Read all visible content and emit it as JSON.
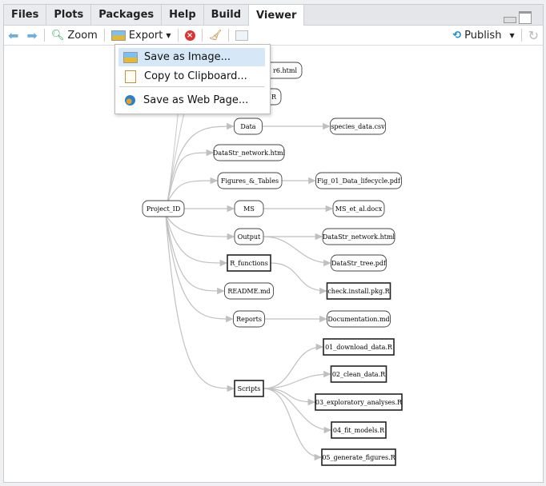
{
  "tabs": [
    {
      "label": "Files"
    },
    {
      "label": "Plots"
    },
    {
      "label": "Packages"
    },
    {
      "label": "Help"
    },
    {
      "label": "Build"
    },
    {
      "label": "Viewer",
      "active": true
    }
  ],
  "toolbar": {
    "back_icon": "arrow-left-icon",
    "forward_icon": "arrow-right-icon",
    "zoom_label": "Zoom",
    "export_label": "Export",
    "publish_label": "Publish"
  },
  "export_menu": {
    "items": [
      {
        "label": "Save as Image...",
        "icon": "image-icon"
      },
      {
        "label": "Copy to Clipboard...",
        "icon": "clipboard-icon"
      },
      {
        "label": "Save as Web Page...",
        "icon": "globe-icon"
      }
    ]
  },
  "colors": {
    "accent": "#1a8fd6",
    "menu_highlight": "#d6e8f8",
    "edge": "#c0c0c0"
  },
  "diagram": {
    "nodes": [
      {
        "id": "root",
        "label": "Project_ID",
        "shape": "rounded"
      },
      {
        "id": "h1",
        "label": "r6.html",
        "shape": "rounded"
      },
      {
        "id": "h2",
        "label": "R",
        "shape": "rounded"
      },
      {
        "id": "data",
        "label": "Data",
        "shape": "rounded"
      },
      {
        "id": "species",
        "label": "species_data.csv",
        "shape": "rounded"
      },
      {
        "id": "dsn1",
        "label": "DataStr_network.html",
        "shape": "rounded"
      },
      {
        "id": "fig",
        "label": "Figures_&_Tables",
        "shape": "rounded"
      },
      {
        "id": "fig01",
        "label": "Fig_01_Data_lifecycle.pdf",
        "shape": "rounded"
      },
      {
        "id": "ms",
        "label": "MS",
        "shape": "rounded"
      },
      {
        "id": "msdoc",
        "label": "MS_et_al.docx",
        "shape": "rounded"
      },
      {
        "id": "output",
        "label": "Output",
        "shape": "rounded"
      },
      {
        "id": "dsn2",
        "label": "DataStr_network.html",
        "shape": "rounded"
      },
      {
        "id": "rfun",
        "label": "R_functions",
        "shape": "rect"
      },
      {
        "id": "tree",
        "label": "DataStr_tree.pdf",
        "shape": "rounded"
      },
      {
        "id": "readme",
        "label": "README.md",
        "shape": "rounded"
      },
      {
        "id": "check",
        "label": "check.install.pkg.R",
        "shape": "rect"
      },
      {
        "id": "reports",
        "label": "Reports",
        "shape": "rounded"
      },
      {
        "id": "doc",
        "label": "Documentation.md",
        "shape": "rounded"
      },
      {
        "id": "s01",
        "label": "01_download_data.R",
        "shape": "rect"
      },
      {
        "id": "s02",
        "label": "02_clean_data.R",
        "shape": "rect"
      },
      {
        "id": "scripts",
        "label": "Scripts",
        "shape": "rect"
      },
      {
        "id": "s03",
        "label": "03_exploratory_analyses.R",
        "shape": "rect"
      },
      {
        "id": "s04",
        "label": "04_fit_models.R",
        "shape": "rect"
      },
      {
        "id": "s05",
        "label": "05_generate_figures.R",
        "shape": "rect"
      }
    ],
    "edges": [
      [
        "root",
        "data"
      ],
      [
        "root",
        "dsn1"
      ],
      [
        "root",
        "fig"
      ],
      [
        "root",
        "ms"
      ],
      [
        "root",
        "output"
      ],
      [
        "root",
        "rfun"
      ],
      [
        "root",
        "readme"
      ],
      [
        "root",
        "reports"
      ],
      [
        "root",
        "scripts"
      ],
      [
        "data",
        "species"
      ],
      [
        "fig",
        "fig01"
      ],
      [
        "ms",
        "msdoc"
      ],
      [
        "output",
        "dsn2"
      ],
      [
        "output",
        "tree"
      ],
      [
        "rfun",
        "check"
      ],
      [
        "reports",
        "doc"
      ],
      [
        "scripts",
        "s01"
      ],
      [
        "scripts",
        "s02"
      ],
      [
        "scripts",
        "s03"
      ],
      [
        "scripts",
        "s04"
      ],
      [
        "scripts",
        "s05"
      ]
    ]
  }
}
